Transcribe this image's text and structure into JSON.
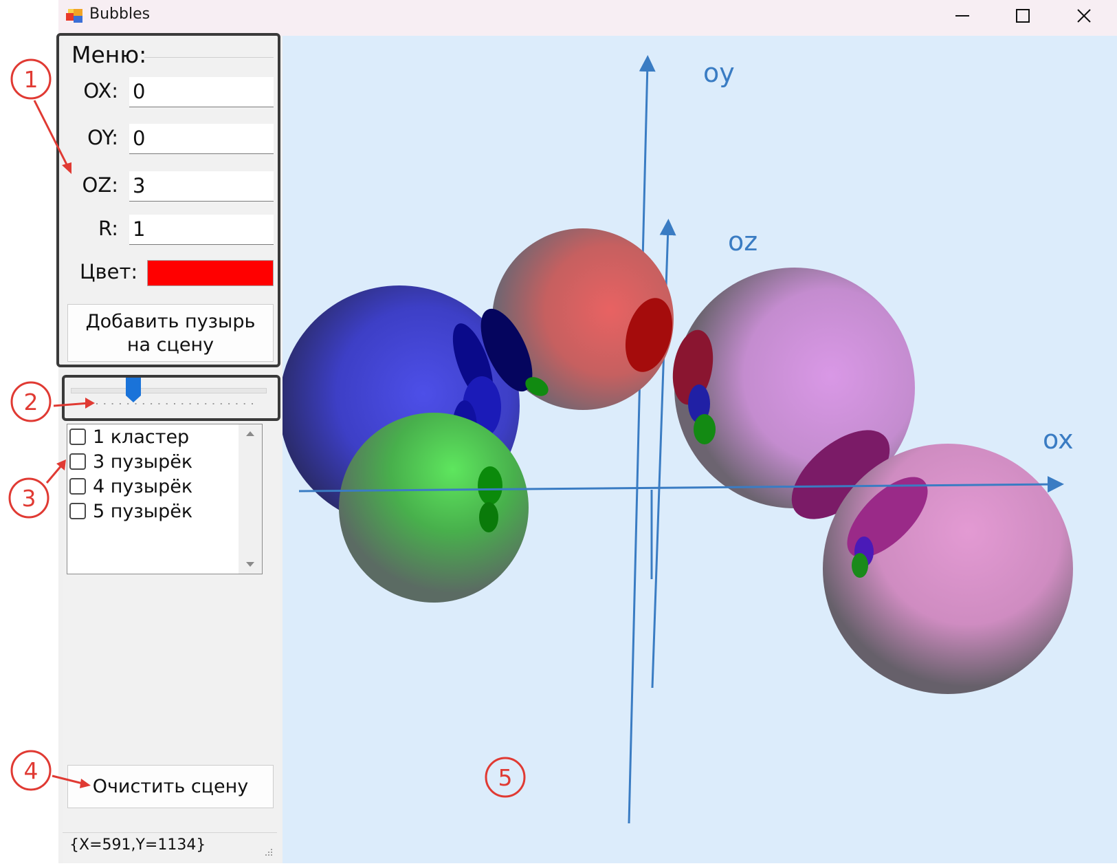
{
  "window": {
    "title": "Bubbles",
    "app_icon": "app-icon",
    "minimize_icon": "minimize-icon",
    "maximize_icon": "maximize-icon",
    "close_icon": "close-icon"
  },
  "menu": {
    "legend": "Меню:",
    "fields": [
      {
        "label": "OX:",
        "value": "0"
      },
      {
        "label": "OY:",
        "value": "0"
      },
      {
        "label": "OZ:",
        "value": "3"
      },
      {
        "label": "R:",
        "value": "1"
      }
    ],
    "color_label": "Цвет:",
    "color_value": "#ff0000",
    "add_button_line1": "Добавить пузырь",
    "add_button_line2": "на сцену"
  },
  "slider": {
    "value_fraction": 0.32
  },
  "list": {
    "items": [
      {
        "label": "1 кластер",
        "checked": false
      },
      {
        "label": "3 пузырёк",
        "checked": false
      },
      {
        "label": "4 пузырёк",
        "checked": false
      },
      {
        "label": "5 пузырёк",
        "checked": false
      }
    ]
  },
  "clear_button": "Очистить сцену",
  "status": "{X=591,Y=1134}",
  "scene": {
    "axis_labels": {
      "x": "ox",
      "y": "oy",
      "z": "oz"
    },
    "axis_color": "#3a7cc3",
    "background_color": "#dcecfb",
    "bubble_colors": [
      "#3d3fc6",
      "#d65a5a",
      "#4fd44f",
      "#c98fd6",
      "#d98bc8"
    ]
  },
  "callouts": [
    "1",
    "2",
    "3",
    "4",
    "5"
  ],
  "callout_color": "#e03a33"
}
